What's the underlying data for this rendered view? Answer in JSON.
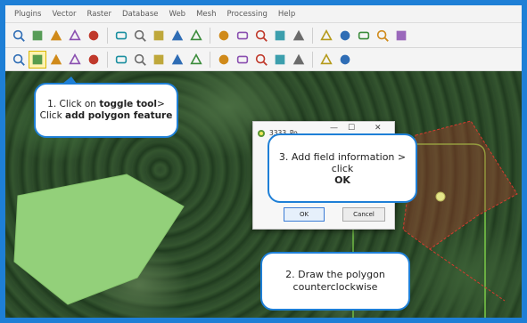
{
  "menu": [
    "Plugins",
    "Vector",
    "Raster",
    "Database",
    "Web",
    "Mesh",
    "Processing",
    "Help"
  ],
  "toolbar1_icons": [
    "pan-hand-icon",
    "pan-to-selection-icon",
    "zoom-in-icon",
    "zoom-out-icon",
    "zoom-full-icon",
    "zoom-to-selection-icon",
    "zoom-to-layer-icon",
    "zoom-native-icon",
    "zoom-last-icon",
    "zoom-next-icon",
    "new-bookmark-icon",
    "show-bookmarks-icon",
    "refresh-icon",
    "temporal-controller-icon",
    "select-features-icon",
    "deselect-icon",
    "identify-icon",
    "open-attribute-table-icon",
    "field-calculator-icon",
    "statistics-icon"
  ],
  "toolbar2_icons": [
    "digitizing-icon",
    "pencil-edit-icon",
    "save-edits-icon",
    "add-polygon-icon",
    "vertex-tool-icon",
    "move-feature-icon",
    "delete-selected-icon",
    "cut-features-icon",
    "copy-features-icon",
    "paste-features-icon",
    "undo-icon",
    "redo-icon",
    "label-tool-icon",
    "style-manager-icon",
    "layer-tool-icon",
    "clear-icon",
    "annotation-icon"
  ],
  "dialog": {
    "title": "3333_Po",
    "minimize": "—",
    "maximize": "☐",
    "close": "✕",
    "ok": "OK",
    "cancel": "Cancel"
  },
  "callouts": {
    "step1_a": "1. Click on ",
    "step1_b": "toggle tool",
    "step1_c": "> Click ",
    "step1_d": "add polygon feature",
    "step3_a": "3. Add field information > click",
    "step3_b": "OK",
    "step2": "2. Draw the polygon counterclockwise"
  },
  "colors": {
    "accent": "#1e7fd6",
    "polygon_fill": "#93d07a",
    "digitized_polygon": "#c0392b",
    "boundary": "#7fd34a"
  }
}
